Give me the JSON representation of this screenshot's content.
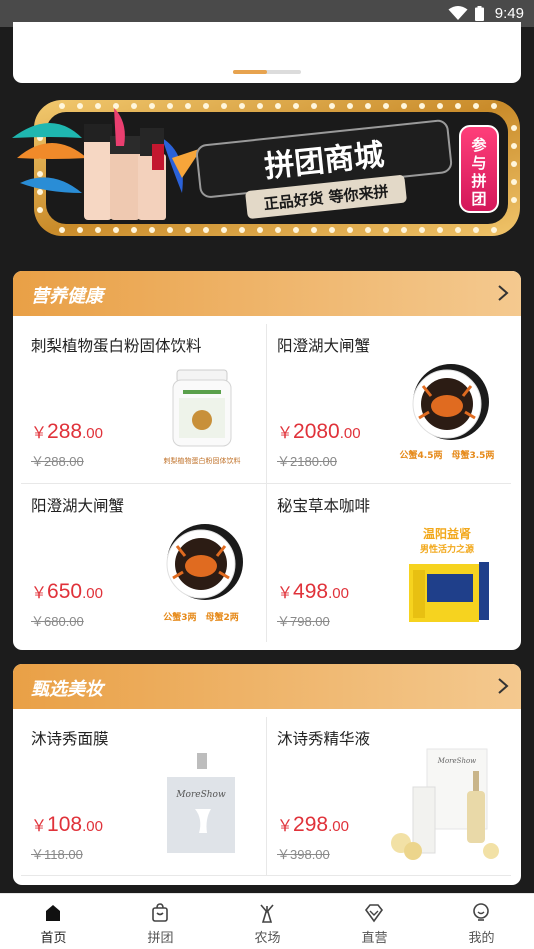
{
  "status_bar": {
    "time": "9:49"
  },
  "banner": {
    "title": "拼团商城",
    "subtitle": "正品好货 等你来拼",
    "side_badge": "参与拼团"
  },
  "sections": [
    {
      "title": "营养健康",
      "items": [
        {
          "name": "刺梨植物蛋白粉固体饮料",
          "price_symbol": "￥",
          "price_int": "288",
          "price_dec": ".00",
          "old_price": "￥288.00",
          "image_caption": "刺梨植物蛋白粉固体饮料"
        },
        {
          "name": "阳澄湖大闸蟹",
          "price_symbol": "￥",
          "price_int": "2080",
          "price_dec": ".00",
          "old_price": "￥2180.00",
          "image_caption": "公蟹4.5两　母蟹3.5两"
        },
        {
          "name": "阳澄湖大闸蟹",
          "price_symbol": "￥",
          "price_int": "650",
          "price_dec": ".00",
          "old_price": "￥680.00",
          "image_caption": "公蟹3两　母蟹2两"
        },
        {
          "name": "秘宝草本咖啡",
          "price_symbol": "￥",
          "price_int": "498",
          "price_dec": ".00",
          "old_price": "￥798.00",
          "image_caption": "温阳益肾",
          "image_caption2": "男性活力之源"
        }
      ]
    },
    {
      "title": "甄选美妆",
      "items": [
        {
          "name": "沐诗秀面膜",
          "price_symbol": "￥",
          "price_int": "108",
          "price_dec": ".00",
          "old_price": "￥118.00",
          "image_caption": "MoreShow"
        },
        {
          "name": "沐诗秀精华液",
          "price_symbol": "￥",
          "price_int": "298",
          "price_dec": ".00",
          "old_price": "￥398.00",
          "image_caption": "MoreShow"
        }
      ]
    }
  ],
  "tabs": [
    {
      "label": "首页",
      "icon": "home-icon",
      "active": true
    },
    {
      "label": "拼团",
      "icon": "bag-icon"
    },
    {
      "label": "农场",
      "icon": "windmill-icon"
    },
    {
      "label": "直营",
      "icon": "diamond-icon"
    },
    {
      "label": "我的",
      "icon": "user-icon"
    }
  ],
  "colors": {
    "accent": "#e9a046",
    "price": "#e0323a",
    "background": "#1c1c1c"
  }
}
